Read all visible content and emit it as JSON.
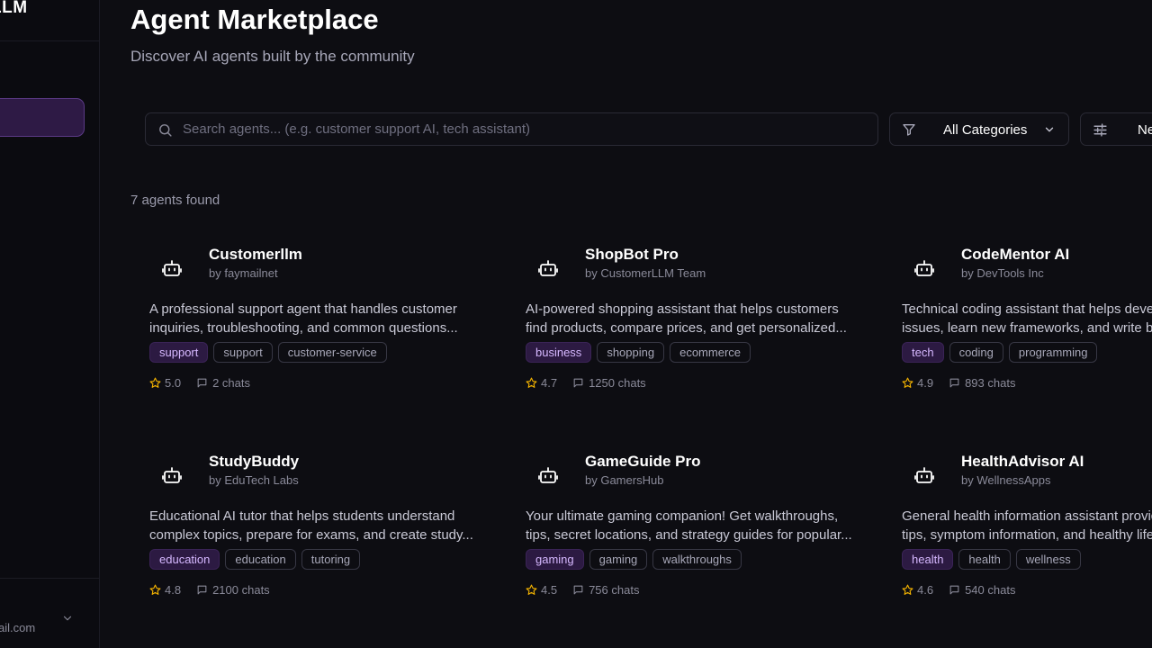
{
  "brand": {
    "text": "LLM"
  },
  "sidebar": {
    "user_email": "ail.com"
  },
  "header": {
    "title": "Agent Marketplace",
    "subtitle": "Discover AI agents built by the community"
  },
  "search": {
    "placeholder": "Search agents... (e.g. customer support AI, tech assistant)",
    "value": ""
  },
  "filters": {
    "category_label": "All Categories",
    "sort_label": "Ne"
  },
  "results": {
    "count_text": "7 agents found"
  },
  "colors": {
    "accent": "#a855f7",
    "tag_primary_bg": "#2c1a42",
    "star": "#f5b400",
    "background": "#0d0d12"
  },
  "icons": {
    "search": "search-icon",
    "filter": "filter-icon",
    "sliders": "sliders-icon",
    "bot": "bot-icon",
    "star": "star-icon",
    "chat": "chat-icon"
  },
  "agents": [
    {
      "name": "Customerllm",
      "author": "by faymailnet",
      "desc_line1": "A professional support agent that handles customer",
      "desc_line2": "inquiries, troubleshooting, and common questions...",
      "tags": [
        "support",
        "support",
        "customer-service"
      ],
      "rating": "5.0",
      "chats": "2 chats"
    },
    {
      "name": "ShopBot Pro",
      "author": "by CustomerLLM Team",
      "desc_line1": "AI-powered shopping assistant that helps customers",
      "desc_line2": "find products, compare prices, and get personalized...",
      "tags": [
        "business",
        "shopping",
        "ecommerce"
      ],
      "rating": "4.7",
      "chats": "1250 chats"
    },
    {
      "name": "CodeMentor AI",
      "author": "by DevTools Inc",
      "desc_line1": "Technical coding assistant that helps develo",
      "desc_line2": "issues, learn new frameworks, and write bet",
      "tags": [
        "tech",
        "coding",
        "programming"
      ],
      "rating": "4.9",
      "chats": "893 chats"
    },
    {
      "name": "StudyBuddy",
      "author": "by EduTech Labs",
      "desc_line1": "Educational AI tutor that helps students understand",
      "desc_line2": "complex topics, prepare for exams, and create study...",
      "tags": [
        "education",
        "education",
        "tutoring"
      ],
      "rating": "4.8",
      "chats": "2100 chats"
    },
    {
      "name": "GameGuide Pro",
      "author": "by GamersHub",
      "desc_line1": "Your ultimate gaming companion! Get walkthroughs,",
      "desc_line2": "tips, secret locations, and strategy guides for popular...",
      "tags": [
        "gaming",
        "gaming",
        "walkthroughs"
      ],
      "rating": "4.5",
      "chats": "756 chats"
    },
    {
      "name": "HealthAdvisor AI",
      "author": "by WellnessApps",
      "desc_line1": "General health information assistant providi",
      "desc_line2": "tips, symptom information, and healthy lifes",
      "tags": [
        "health",
        "health",
        "wellness"
      ],
      "rating": "4.6",
      "chats": "540 chats"
    }
  ]
}
